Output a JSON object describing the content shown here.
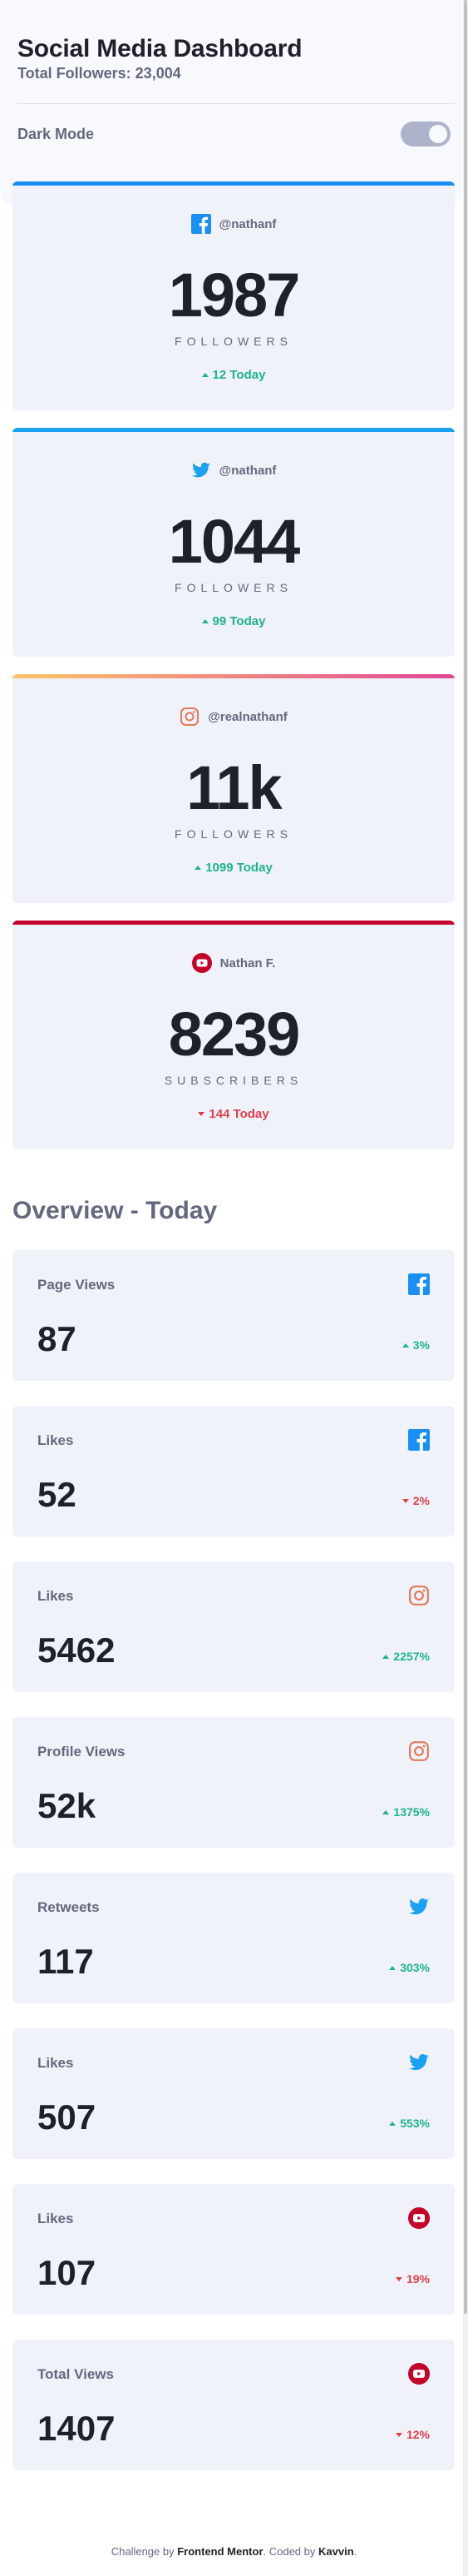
{
  "header": {
    "title": "Social Media Dashboard",
    "total_followers": "Total Followers: 23,004",
    "dark_mode_label": "Dark Mode",
    "dark_mode_on": false
  },
  "colors": {
    "facebook": "#198ff5",
    "twitter": "#1ca0f2",
    "instagram_gradient": [
      "#fdc468",
      "#df4996"
    ],
    "youtube": "#c4032a",
    "up": "#1db489",
    "down": "#dc414c"
  },
  "follower_cards": [
    {
      "network": "facebook",
      "icon": "facebook-icon",
      "handle": "@nathanf",
      "count": "1987",
      "unit": "FOLLOWERS",
      "change": "12 Today",
      "direction": "up"
    },
    {
      "network": "twitter",
      "icon": "twitter-icon",
      "handle": "@nathanf",
      "count": "1044",
      "unit": "FOLLOWERS",
      "change": "99 Today",
      "direction": "up"
    },
    {
      "network": "instagram",
      "icon": "instagram-icon",
      "handle": "@realnathanf",
      "count": "11k",
      "unit": "FOLLOWERS",
      "change": "1099 Today",
      "direction": "up"
    },
    {
      "network": "youtube",
      "icon": "youtube-icon",
      "handle": "Nathan F.",
      "count": "8239",
      "unit": "SUBSCRIBERS",
      "change": "144 Today",
      "direction": "down"
    }
  ],
  "overview": {
    "title": "Overview - Today",
    "cards": [
      {
        "label": "Page Views",
        "icon": "facebook-icon",
        "value": "87",
        "change": "3%",
        "direction": "up"
      },
      {
        "label": "Likes",
        "icon": "facebook-icon",
        "value": "52",
        "change": "2%",
        "direction": "down"
      },
      {
        "label": "Likes",
        "icon": "instagram-icon",
        "value": "5462",
        "change": "2257%",
        "direction": "up"
      },
      {
        "label": "Profile Views",
        "icon": "instagram-icon",
        "value": "52k",
        "change": "1375%",
        "direction": "up"
      },
      {
        "label": "Retweets",
        "icon": "twitter-icon",
        "value": "117",
        "change": "303%",
        "direction": "up"
      },
      {
        "label": "Likes",
        "icon": "twitter-icon",
        "value": "507",
        "change": "553%",
        "direction": "up"
      },
      {
        "label": "Likes",
        "icon": "youtube-icon",
        "value": "107",
        "change": "19%",
        "direction": "down"
      },
      {
        "label": "Total Views",
        "icon": "youtube-icon",
        "value": "1407",
        "change": "12%",
        "direction": "down"
      }
    ]
  },
  "footer": {
    "prefix": "Challenge by",
    "link1": "Frontend Mentor",
    "middle": ". Coded by",
    "link2": "Kavvin",
    "suffix": "."
  }
}
